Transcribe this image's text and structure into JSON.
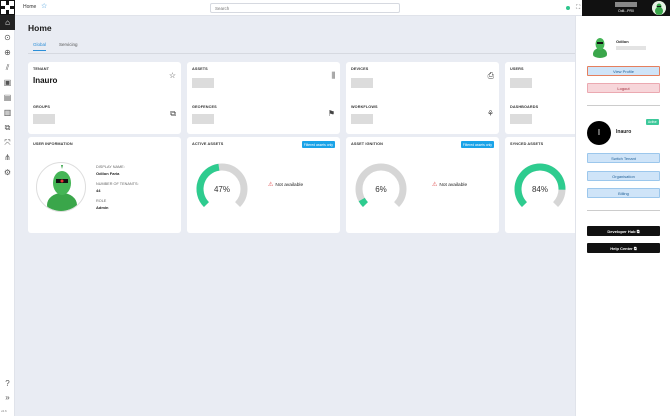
{
  "header": {
    "breadcrumb": "Home",
    "search_placeholder": "Search",
    "user_short": "Odil...PR0",
    "icons": [
      "star-icon",
      "status-dot-icon",
      "fullscreen-icon",
      "help-icon",
      "bell-icon"
    ]
  },
  "sidebar": {
    "icons": [
      "home-icon",
      "location-icon",
      "globe-search-icon",
      "chart-icon",
      "camera-icon",
      "document-icon",
      "report-icon",
      "geofence-icon",
      "workflow-icon",
      "hierarchy-icon",
      "settings-icon"
    ],
    "version": "v2.6"
  },
  "page": {
    "title": "Home",
    "tabs": [
      {
        "label": "Global",
        "active": true
      },
      {
        "label": "Servicing",
        "active": false
      }
    ]
  },
  "cards": {
    "tenant": {
      "label": "TENANT",
      "value": "Inauro"
    },
    "assets": {
      "label": "ASSETS"
    },
    "devices": {
      "label": "DEVICES"
    },
    "users": {
      "label": "USERS"
    },
    "groups": {
      "label": "GROUPS"
    },
    "geofences": {
      "label": "GEOFENCES"
    },
    "workflows": {
      "label": "WORKFLOWS"
    },
    "dashboards": {
      "label": "DASHBOARDS"
    }
  },
  "user_info": {
    "label": "USER INFORMATION",
    "display_name_label": "DISPLAY NAME:",
    "display_name": "Odilon Faria",
    "tenants_label": "NUMBER OF TENANTS:",
    "tenants": "44",
    "role_label": "ROLE",
    "role": "Admin"
  },
  "gauges": {
    "active_assets": {
      "label": "ACTIVE ASSETS",
      "badge": "Filtered assets only",
      "percent": 47,
      "text": "47%",
      "not_available": "Not available"
    },
    "asset_ignition": {
      "label": "ASSET IGNITION",
      "badge": "Filtered assets only",
      "percent": 6,
      "text": "6%",
      "not_available": "Not available"
    },
    "synced_assets": {
      "label": "SYNCED ASSETS",
      "percent": 84,
      "text": "84%"
    }
  },
  "right_panel": {
    "user_name": "Odilon",
    "view_profile": "View Profile",
    "logout": "Logout",
    "tenant_initial": "I",
    "tenant_name": "Inauro",
    "active_badge": "Active",
    "switch_tenant": "Switch Tenant",
    "organisation": "Organisation",
    "billing": "Billing",
    "developer_hub": "Developer Hub",
    "help_center": "Help Center"
  },
  "colors": {
    "accent": "#2c8fd8",
    "gauge_fill": "#2ecc8f",
    "gauge_track": "#d6d6d6",
    "badge": "#1aa3e8"
  }
}
